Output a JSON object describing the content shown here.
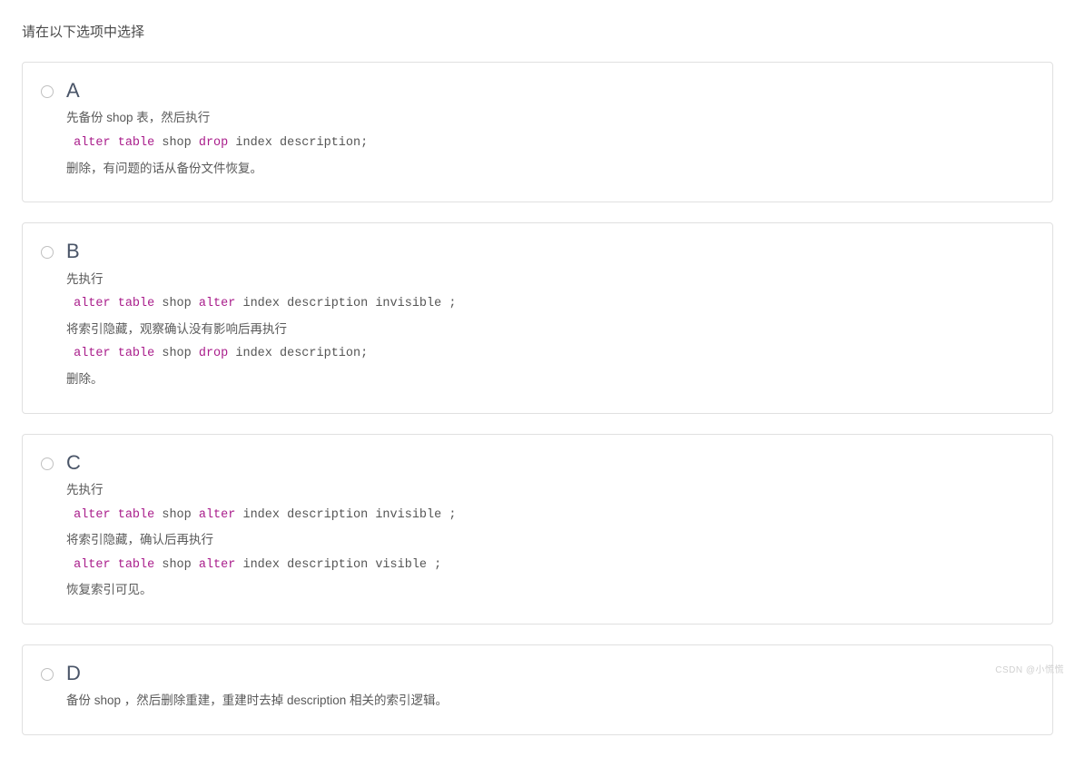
{
  "prompt": "请在以下选项中选择",
  "options": [
    {
      "letter": "A",
      "lines": [
        {
          "type": "text",
          "value": "先备份 shop 表，然后执行"
        },
        {
          "type": "code",
          "tokens": [
            {
              "t": " ",
              "kw": false
            },
            {
              "t": "alter",
              "kw": true
            },
            {
              "t": " ",
              "kw": false
            },
            {
              "t": "table",
              "kw": true
            },
            {
              "t": " shop ",
              "kw": false
            },
            {
              "t": "drop",
              "kw": true
            },
            {
              "t": " ",
              "kw": false
            },
            {
              "t": "index",
              "kw": false
            },
            {
              "t": " description;",
              "kw": false
            }
          ]
        },
        {
          "type": "text",
          "value": "删除，有问题的话从备份文件恢复。"
        }
      ]
    },
    {
      "letter": "B",
      "lines": [
        {
          "type": "text",
          "value": "先执行"
        },
        {
          "type": "code",
          "tokens": [
            {
              "t": " ",
              "kw": false
            },
            {
              "t": "alter",
              "kw": true
            },
            {
              "t": " ",
              "kw": false
            },
            {
              "t": "table",
              "kw": true
            },
            {
              "t": " shop ",
              "kw": false
            },
            {
              "t": "alter",
              "kw": true
            },
            {
              "t": " ",
              "kw": false
            },
            {
              "t": "index",
              "kw": false
            },
            {
              "t": " description invisible ;",
              "kw": false
            }
          ]
        },
        {
          "type": "text",
          "value": "将索引隐藏，观察确认没有影响后再执行"
        },
        {
          "type": "code",
          "tokens": [
            {
              "t": " ",
              "kw": false
            },
            {
              "t": "alter",
              "kw": true
            },
            {
              "t": " ",
              "kw": false
            },
            {
              "t": "table",
              "kw": true
            },
            {
              "t": " shop ",
              "kw": false
            },
            {
              "t": "drop",
              "kw": true
            },
            {
              "t": " ",
              "kw": false
            },
            {
              "t": "index",
              "kw": false
            },
            {
              "t": " description;",
              "kw": false
            }
          ]
        },
        {
          "type": "text",
          "value": "删除。"
        }
      ]
    },
    {
      "letter": "C",
      "lines": [
        {
          "type": "text",
          "value": "先执行"
        },
        {
          "type": "code",
          "tokens": [
            {
              "t": " ",
              "kw": false
            },
            {
              "t": "alter",
              "kw": true
            },
            {
              "t": " ",
              "kw": false
            },
            {
              "t": "table",
              "kw": true
            },
            {
              "t": " shop ",
              "kw": false
            },
            {
              "t": "alter",
              "kw": true
            },
            {
              "t": " ",
              "kw": false
            },
            {
              "t": "index",
              "kw": false
            },
            {
              "t": " description invisible ;",
              "kw": false
            }
          ]
        },
        {
          "type": "text",
          "value": "将索引隐藏，确认后再执行"
        },
        {
          "type": "code",
          "tokens": [
            {
              "t": " ",
              "kw": false
            },
            {
              "t": "alter",
              "kw": true
            },
            {
              "t": " ",
              "kw": false
            },
            {
              "t": "table",
              "kw": true
            },
            {
              "t": " shop ",
              "kw": false
            },
            {
              "t": "alter",
              "kw": true
            },
            {
              "t": " ",
              "kw": false
            },
            {
              "t": "index",
              "kw": false
            },
            {
              "t": " description visible ;",
              "kw": false
            }
          ]
        },
        {
          "type": "text",
          "value": "恢复索引可见。"
        }
      ]
    },
    {
      "letter": "D",
      "lines": [
        {
          "type": "text",
          "value": "备份 shop ，然后删除重建，重建时去掉 description 相关的索引逻辑。"
        }
      ]
    }
  ],
  "watermark": "CSDN @小慌慌"
}
